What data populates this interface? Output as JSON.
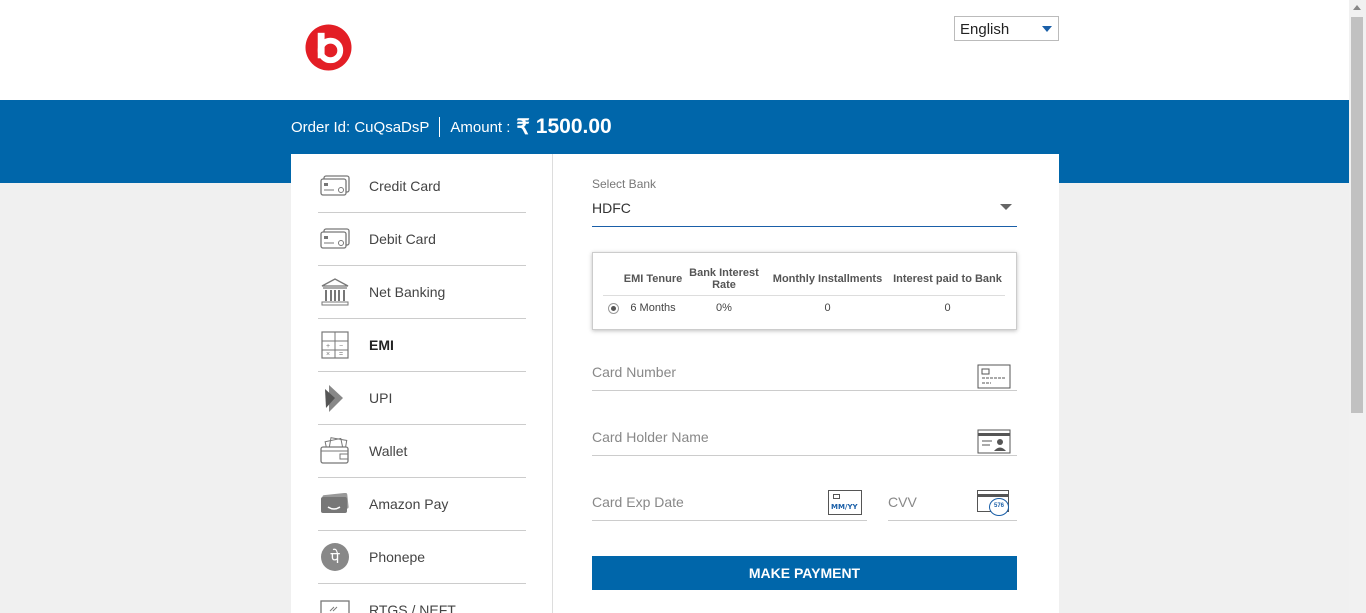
{
  "header": {
    "logo_icon": "beats-logo-icon",
    "brand_color": "#e31e25",
    "language": "English"
  },
  "order": {
    "order_id_label": "Order Id: CuQsaDsP",
    "amount_label": "Amount :",
    "currency_symbol": "₹",
    "amount_value": "1500.00"
  },
  "sidebar": {
    "items": [
      {
        "label": "Credit Card",
        "icon": "credit-card-icon"
      },
      {
        "label": "Debit Card",
        "icon": "debit-card-icon"
      },
      {
        "label": "Net Banking",
        "icon": "bank-icon"
      },
      {
        "label": "EMI",
        "icon": "calculator-icon"
      },
      {
        "label": "UPI",
        "icon": "upi-icon"
      },
      {
        "label": "Wallet",
        "icon": "wallet-icon"
      },
      {
        "label": "Amazon Pay",
        "icon": "amazon-pay-icon"
      },
      {
        "label": "Phonepe",
        "icon": "phonepe-icon"
      },
      {
        "label": "RTGS / NEFT",
        "icon": "rtgs-icon"
      }
    ]
  },
  "emi_form": {
    "bank_label": "Select Bank",
    "bank_value": "HDFC",
    "table": {
      "headers": [
        "EMI Tenure",
        "Bank Interest Rate",
        "Monthly Installments",
        "Interest paid to Bank"
      ],
      "rows": [
        {
          "tenure": "6 Months",
          "rate": "0%",
          "installments": "0",
          "interest": "0"
        }
      ]
    },
    "card_number_placeholder": "Card Number",
    "card_holder_placeholder": "Card Holder Name",
    "card_exp_placeholder": "Card Exp Date",
    "cvv_placeholder": "CVV",
    "cvv_sample": "576",
    "exp_icon_text": "MM/YY",
    "submit_label": "MAKE PAYMENT"
  },
  "colors": {
    "primary": "#0066aa",
    "background": "#f0f0f0"
  }
}
